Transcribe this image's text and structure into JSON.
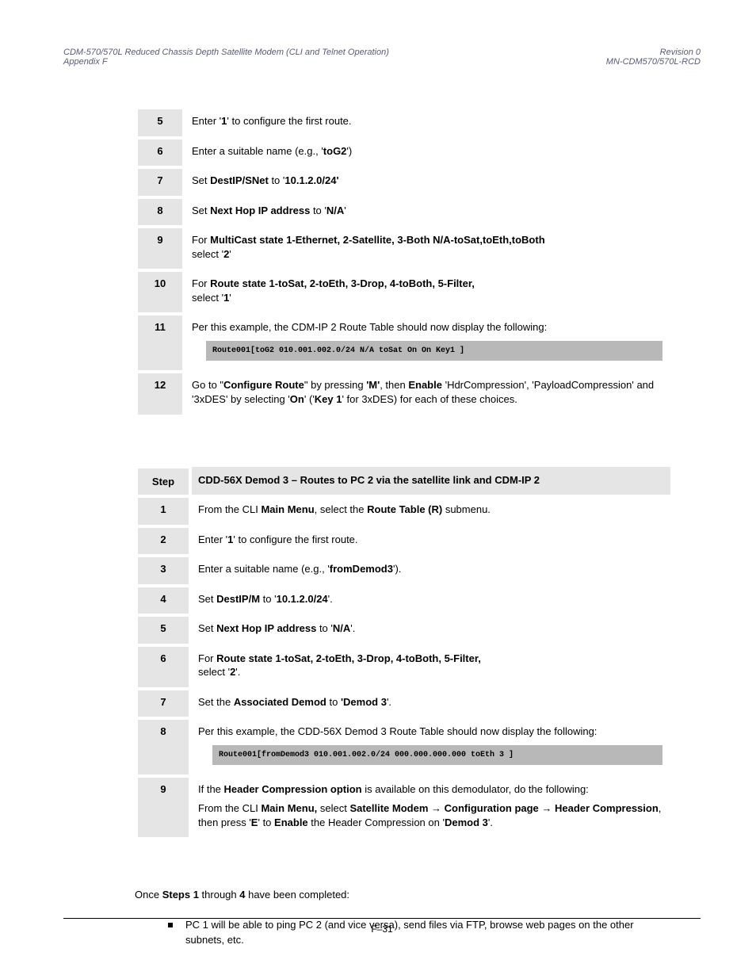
{
  "header": {
    "left_line1": "CDM-570/570L Reduced Chassis Depth Satellite Modem (CLI and Telnet Operation)",
    "left_line2": "Appendix F",
    "right_line1": "Revision 0",
    "right_line2": "MN-CDM570/570L-RCD"
  },
  "table1": {
    "rows": [
      {
        "step": "5",
        "parts": [
          "Enter '",
          "1",
          "' to configure the first route."
        ]
      },
      {
        "step": "6",
        "parts": [
          "Enter a suitable name (e.g., '",
          "toG2",
          "')"
        ]
      },
      {
        "step": "7",
        "parts": [
          "Set ",
          "DestIP/SNet",
          " to '",
          "10.1.2.0/24'"
        ]
      },
      {
        "step": "8",
        "parts": [
          "Set ",
          "Next Hop IP address",
          " to '",
          "N/A",
          "'"
        ]
      },
      {
        "step": "9",
        "parts": [
          "For ",
          "MultiCast state 1-Ethernet, 2-Satellite, 3-Both N/A-toSat,toEth,toBoth",
          "\nselect '",
          "2",
          "'"
        ]
      },
      {
        "step": "10",
        "parts": [
          "For ",
          "Route state 1-toSat, 2-toEth, 3-Drop, 4-toBoth, 5-Filter,",
          "\nselect '",
          "1",
          "'"
        ]
      },
      {
        "step": "11",
        "intro": "Per this example, the CDM-IP 2 Route Table should now display the following:",
        "routebar": "Route001[toG2    010.001.002.0/24 N/A             toSat  On    On   Key1  ]"
      },
      {
        "step": "12",
        "parts": [
          "Go to \"",
          "Configure Route",
          "\" by pressing ",
          "'M'",
          ", then ",
          "Enable",
          " 'HdrCompression', 'PayloadCompression' and '3xDES' by selecting '",
          "On",
          "' ('",
          "Key 1",
          "' for 3xDES) for each of these choices."
        ]
      }
    ]
  },
  "table2": {
    "head_step": "Step",
    "head_desc": "CDD-56X Demod 3 – Routes to PC 2 via the satellite link and CDM-IP 2",
    "rows": [
      {
        "step": "1",
        "parts": [
          "From the CLI ",
          "Main Menu",
          ", select the ",
          "Route Table (R)",
          " submenu."
        ]
      },
      {
        "step": "2",
        "parts": [
          "Enter '",
          "1",
          "' to configure the first route."
        ]
      },
      {
        "step": "3",
        "parts": [
          "Enter a suitable name (e.g., '",
          "fromDemod3",
          "')."
        ]
      },
      {
        "step": "4",
        "parts": [
          "Set ",
          "DestIP/M",
          " to '",
          "10.1.2.0/24",
          "'."
        ]
      },
      {
        "step": "5",
        "parts": [
          "Set ",
          "Next Hop IP address",
          " to '",
          "N/A",
          "'."
        ]
      },
      {
        "step": "6",
        "parts": [
          "For ",
          "Route state 1-toSat, 2-toEth, 3-Drop, 4-toBoth, 5-Filter,",
          "\nselect '",
          "2",
          "'."
        ]
      },
      {
        "step": "7",
        "parts": [
          "Set the ",
          "Associated Demod",
          " to ",
          "'Demod 3",
          "'."
        ]
      },
      {
        "step": "8",
        "intro": "Per this example, the CDD-56X Demod 3 Route Table should now display the following:",
        "routebar": "Route001[fromDemod3  010.001.002.0/24 000.000.000.000  toEth  3  ]"
      },
      {
        "step": "9",
        "lines": [
          [
            "If the ",
            "Header Compression option",
            " is available on this demodulator, do the following:"
          ],
          [
            "From the CLI ",
            "Main Menu, ",
            "select ",
            "Satellite Modem ",
            {
              "arrow": true
            },
            " Configuration page ",
            {
              "arrow": true
            },
            " Header Compression",
            ", then press '",
            "E",
            "' to ",
            "Enable",
            " the Header Compression on '",
            "Demod 3",
            "'."
          ]
        ]
      }
    ]
  },
  "after": {
    "lead": "Once ",
    "bold1": "Steps 1 ",
    "mid": "through ",
    "bold2": "4 ",
    "tail": "have been completed:",
    "bullet": "PC 1 will be able to ping PC 2 (and vice versa), send files via FTP, browse web pages on the other subnets, etc."
  },
  "footer": "F–31"
}
